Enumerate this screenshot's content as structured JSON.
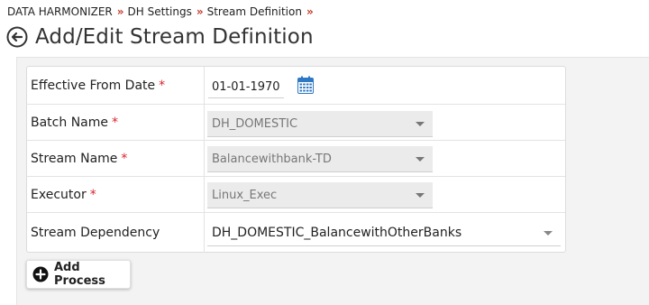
{
  "breadcrumb": {
    "items": [
      "DATA HARMONIZER",
      "DH Settings",
      "Stream Definition"
    ],
    "separator": "»"
  },
  "page": {
    "title": "Add/Edit Stream Definition"
  },
  "form": {
    "effective_from_date": {
      "label": "Effective From Date",
      "required_mark": "*",
      "value": "01-01-1970"
    },
    "batch_name": {
      "label": "Batch Name",
      "required_mark": "*",
      "value": "DH_DOMESTIC"
    },
    "stream_name": {
      "label": "Stream Name",
      "required_mark": "*",
      "value": "Balancewithbank-TD"
    },
    "executor": {
      "label": "Executor",
      "required_mark": "*",
      "value": "Linux_Exec"
    },
    "stream_dependency": {
      "label": "Stream Dependency",
      "value": "DH_DOMESTIC_BalancewithOtherBanks"
    }
  },
  "actions": {
    "add_process_label": "Add Process"
  },
  "colors": {
    "accent_red": "#c0392b",
    "required_red": "#d9232d",
    "calendar_blue": "#2f78c4"
  },
  "icons": [
    "back-arrow-icon",
    "calendar-icon",
    "chevron-down-icon",
    "plus-circle-icon"
  ]
}
